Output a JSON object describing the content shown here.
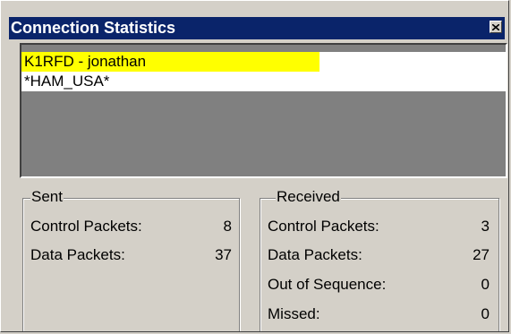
{
  "window": {
    "title": "Connection Statistics"
  },
  "connections": {
    "items": [
      {
        "label": "K1RFD - jonathan",
        "highlighted": true,
        "highlight_color": "#ffff00"
      },
      {
        "label": "*HAM_USA*",
        "highlighted": false
      }
    ]
  },
  "sent": {
    "legend": "Sent",
    "rows": [
      {
        "label": "Control Packets:",
        "value": "8"
      },
      {
        "label": "Data Packets:",
        "value": "37"
      }
    ]
  },
  "received": {
    "legend": "Received",
    "rows": [
      {
        "label": "Control Packets:",
        "value": "3"
      },
      {
        "label": "Data Packets:",
        "value": "27"
      },
      {
        "label": "Out of Sequence:",
        "value": "0"
      },
      {
        "label": "Missed:",
        "value": "0"
      }
    ]
  },
  "colors": {
    "titlebar": "#0a246a",
    "face": "#d4d0c8",
    "list_empty": "#808080",
    "highlight": "#ffff00"
  },
  "icons": {
    "close": "close-icon"
  }
}
